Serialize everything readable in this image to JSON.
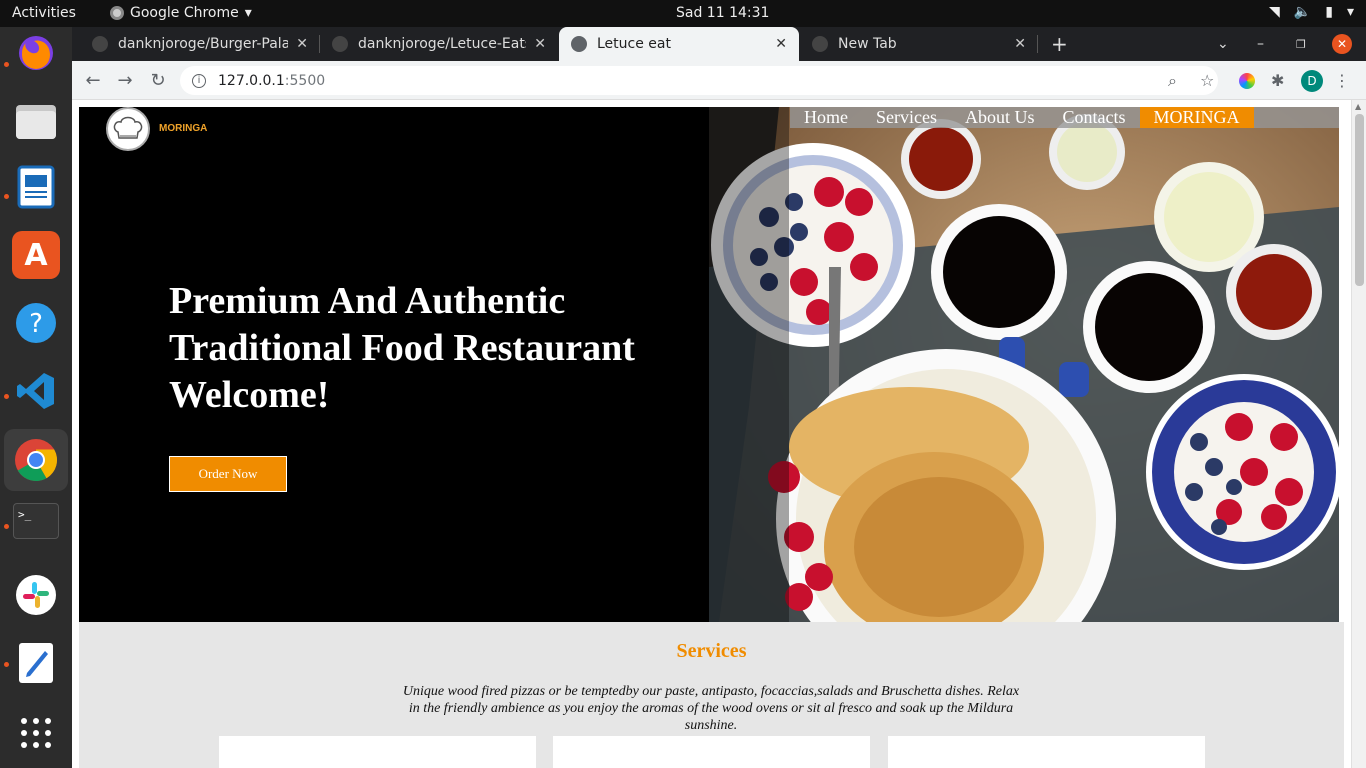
{
  "system": {
    "activities": "Activities",
    "app_name": "Google Chrome",
    "clock": "Sad 11  14:31"
  },
  "tabs": [
    {
      "title": "danknjoroge/Burger-Palace",
      "icon": "github-icon"
    },
    {
      "title": "danknjoroge/Letuce-Eats",
      "icon": "github-icon"
    },
    {
      "title": "Letuce eat",
      "icon": "globe-icon",
      "active": true
    },
    {
      "title": "New Tab",
      "icon": "chrome-icon"
    }
  ],
  "address": {
    "host": "127.0.0.1",
    "port": ":5500"
  },
  "profile_initial": "D",
  "site": {
    "logo_text": "MORINGA",
    "nav": [
      {
        "label": "Home"
      },
      {
        "label": "Services"
      },
      {
        "label": "About Us"
      },
      {
        "label": "Contacts"
      },
      {
        "label": "MORINGA",
        "active": true
      }
    ],
    "hero_title_lines": [
      "Premium And Authentic",
      "Traditional Food Restaurant",
      "Welcome!"
    ],
    "order_button": "Order Now",
    "services_title": "Services",
    "services_desc": "Unique wood fired pizzas or be temptedby our paste, antipasto, focaccias,salads and Bruschetta dishes. Relax in the friendly ambience as you enjoy the aromas of the wood ovens or sit al fresco and soak up the Mildura sunshine."
  },
  "colors": {
    "accent": "#f08c00",
    "hero_bg": "#000000",
    "services_bg": "#e6e6e6"
  }
}
